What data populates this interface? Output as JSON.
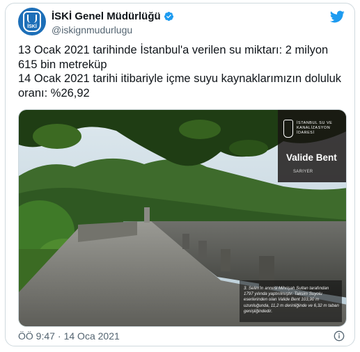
{
  "author": {
    "display_name": "İSKİ Genel Müdürlüğü",
    "handle": "@iskignmudurlugu",
    "avatar_text": "İSKİ"
  },
  "tweet": {
    "line1": "13 Ocak 2021 tarihinde İstanbul'a verilen su miktarı: 2 milyon 615 bin metreküp",
    "line2": "14 Ocak 2021 tarihi itibariyle içme suyu kaynaklarımızın doluluk oranı: %26,92"
  },
  "media": {
    "org_name": "İSTANBUL SU VE KANALİZASYON İDARESİ",
    "logo_text": "İSKİ",
    "title": "Valide Bent",
    "district": "SARIYER",
    "caption": "3. Selim'in annesi Mihrişah Sultan tarafından 1797 yılında yaptırılmıştır. Taksim Suyolu eserlerinden olan Valide Bent 103,90 m uzunluğunda, 11,2 m derinliğinde ve 6,32 m taban genişliğindedir."
  },
  "meta": {
    "time": "ÖÖ 9:47",
    "separator": "·",
    "date": "14 Oca 2021"
  },
  "icons": {
    "brand": "twitter-bird-icon",
    "verified": "verified-badge-icon",
    "info": "info-icon"
  },
  "colors": {
    "twitter_blue": "#1d9bf0",
    "verified_blue": "#1d9bf0",
    "avatar_bg": "#1d6fb8",
    "secondary_text": "#536471"
  }
}
